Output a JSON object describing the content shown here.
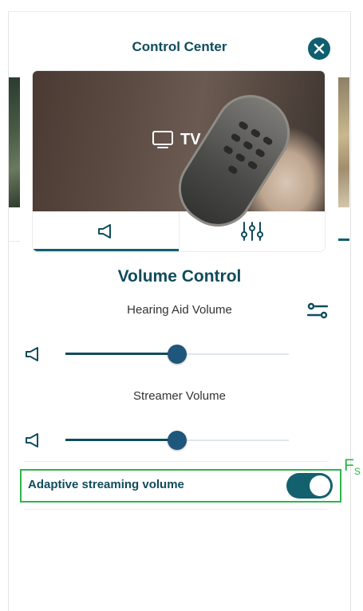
{
  "header": {
    "title": "Control Center",
    "close_icon": "close-icon"
  },
  "device_card": {
    "label": "TV",
    "tv_icon": "tv-icon",
    "tabs": [
      {
        "name": "volume",
        "icon": "speaker-icon",
        "active": true
      },
      {
        "name": "equalizer",
        "icon": "sliders-icon",
        "active": false
      }
    ]
  },
  "volume": {
    "section_title": "Volume Control",
    "hearing_aid_label": "Hearing Aid Volume",
    "hearing_aid_level": 0.5,
    "streamer_label": "Streamer Volume",
    "streamer_level": 0.5,
    "settings_icon": "settings-icon"
  },
  "adaptive": {
    "label": "Adaptive streaming volume",
    "enabled": true
  },
  "annotation": {
    "main": "F",
    "sub": "S"
  },
  "colors": {
    "primary": "#0f4c5c",
    "accent": "#13606e",
    "highlight": "#2fb44a"
  }
}
